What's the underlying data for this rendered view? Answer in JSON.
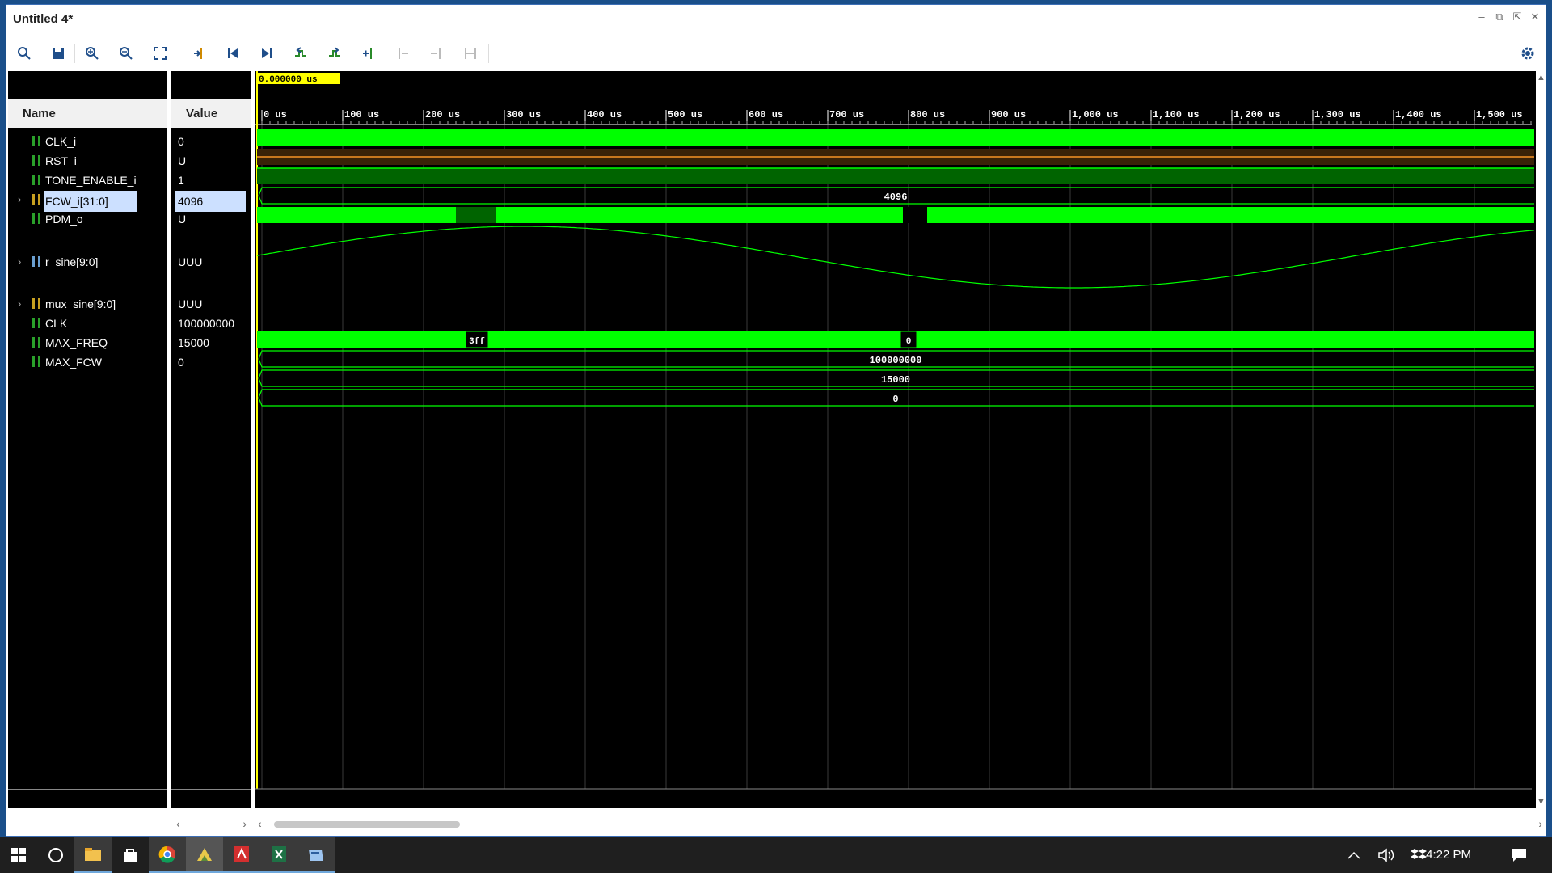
{
  "window": {
    "title": "Untitled 4*"
  },
  "toolbar": {
    "icons": [
      "search-icon",
      "save-icon",
      "zoom-in-icon",
      "zoom-out-icon",
      "zoom-fit-icon",
      "go-to-cursor-icon",
      "go-to-time-0-icon",
      "go-to-last-time-icon",
      "previous-transition-icon",
      "next-transition-icon",
      "add-marker-icon",
      "previous-marker-icon",
      "next-marker-icon",
      "swap-cursors-icon"
    ],
    "settings_icon": "gear-icon"
  },
  "columns": {
    "name": "Name",
    "value": "Value"
  },
  "cursor_time": "0.000000 us",
  "signals": [
    {
      "name": "CLK_i",
      "value": "0",
      "expandable": false,
      "kind": "bit"
    },
    {
      "name": "RST_i",
      "value": "U",
      "expandable": false,
      "kind": "bit"
    },
    {
      "name": "TONE_ENABLE_i",
      "value": "1",
      "expandable": false,
      "kind": "bit"
    },
    {
      "name": "FCW_i[31:0]",
      "value": "4096",
      "expandable": true,
      "kind": "bus",
      "selected": true
    },
    {
      "name": "PDM_o",
      "value": "U",
      "expandable": false,
      "kind": "bit"
    },
    {
      "name": "r_sine[9:0]",
      "value": "UUU",
      "expandable": true,
      "kind": "analog"
    },
    {
      "name": "mux_sine[9:0]",
      "value": "UUU",
      "expandable": true,
      "kind": "bus"
    },
    {
      "name": "CLK",
      "value": "100000000",
      "expandable": false,
      "kind": "param"
    },
    {
      "name": "MAX_FREQ",
      "value": "15000",
      "expandable": false,
      "kind": "param"
    },
    {
      "name": "MAX_FCW",
      "value": "0",
      "expandable": false,
      "kind": "param"
    }
  ],
  "timeline": {
    "ticks": [
      "0 us",
      "100 us",
      "200 us",
      "300 us",
      "400 us",
      "500 us",
      "600 us",
      "700 us",
      "800 us",
      "900 us",
      "1,000 us",
      "1,100 us",
      "1,200 us",
      "1,300 us",
      "1,400 us",
      "1,500 us"
    ]
  },
  "waves": {
    "fcw_label": "4096",
    "mux_labels": [
      "3ff",
      "0"
    ],
    "clk_label": "100000000",
    "max_freq_label": "15000",
    "max_fcw_label": "0"
  },
  "colors": {
    "wave": "#00ff00",
    "wave_dark": "#006400",
    "rst": "#c8781e",
    "cursor": "#ffff00",
    "grid": "#3a3a3a"
  },
  "taskbar": {
    "time": "4:22 PM",
    "icons": [
      "windows-start-icon",
      "cortana-icon",
      "file-explorer-icon",
      "store-icon",
      "chrome-icon",
      "vivado-icon",
      "acrobat-icon",
      "excel-icon",
      "app-icon"
    ],
    "tray_icons": [
      "chevron-up-icon",
      "volume-icon",
      "dropbox-icon",
      "notifications-icon"
    ]
  }
}
